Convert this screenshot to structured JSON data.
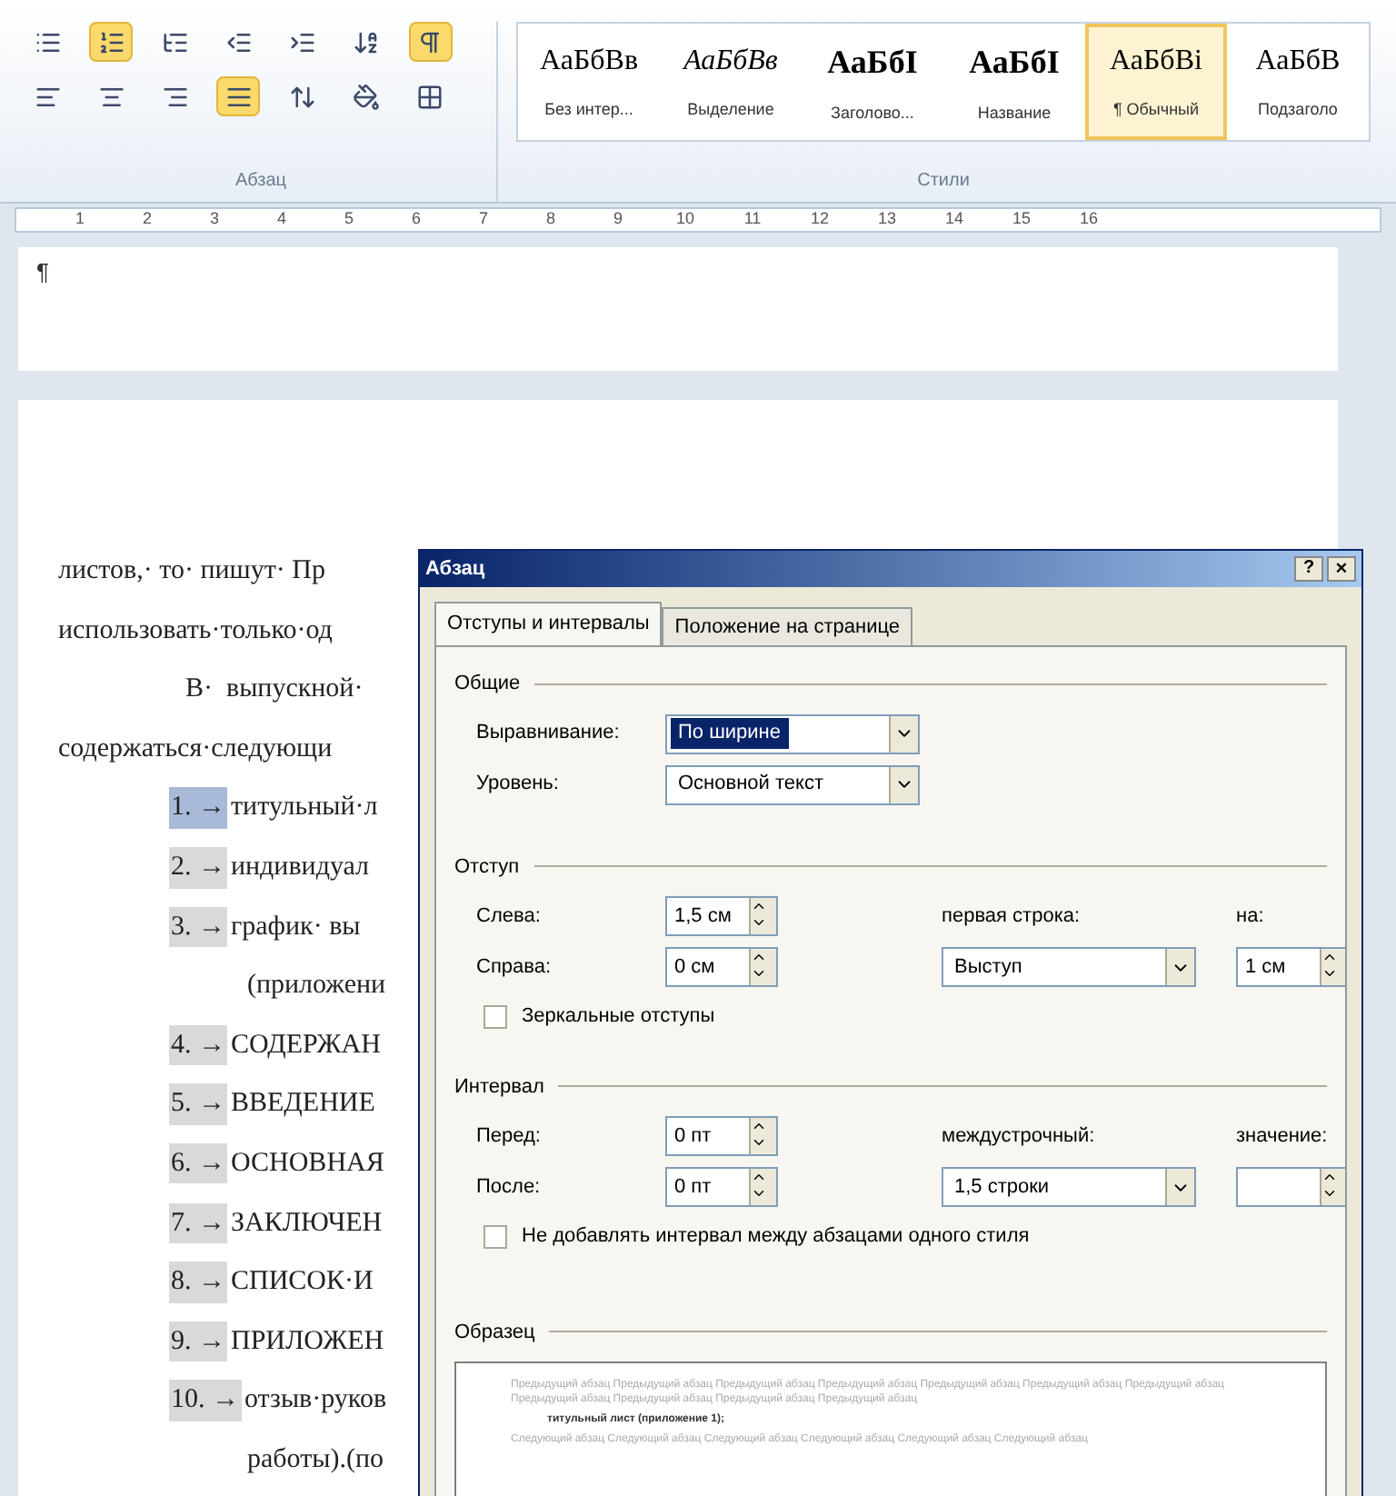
{
  "ribbon": {
    "paragraph_group": {
      "label": "Абзац",
      "tools": [
        {
          "kind": "bullets",
          "on": false
        },
        {
          "kind": "numbering",
          "on": true
        },
        {
          "kind": "multilevel",
          "on": false
        },
        {
          "kind": "outdent",
          "on": false
        },
        {
          "kind": "indent",
          "on": false
        },
        {
          "kind": "sort",
          "on": false
        },
        {
          "kind": "pilcrow",
          "on": true
        },
        {
          "kind": "align-left",
          "on": false
        },
        {
          "kind": "align-center",
          "on": false
        },
        {
          "kind": "align-right",
          "on": false
        },
        {
          "kind": "justify",
          "on": true
        },
        {
          "kind": "line-spacing",
          "on": false
        },
        {
          "kind": "shading",
          "on": false
        },
        {
          "kind": "borders",
          "on": false
        }
      ]
    },
    "styles_group": {
      "label": "Стили",
      "styles": [
        {
          "sample": "АаБбВв",
          "name": "Без интер...",
          "kind": "plain",
          "selected": false
        },
        {
          "sample": "АаБбВв",
          "name": "Выделение",
          "kind": "italic",
          "selected": false
        },
        {
          "sample": "АаБбI",
          "name": "Заголово...",
          "kind": "bold",
          "selected": false
        },
        {
          "sample": "АаБбI",
          "name": "Название",
          "kind": "bold",
          "selected": false
        },
        {
          "sample": "АаБбВі",
          "name": "¶ Обычный",
          "kind": "plain",
          "selected": true
        },
        {
          "sample": "АаБбВ",
          "name": "Подзаголо",
          "kind": "plain",
          "selected": false
        }
      ]
    }
  },
  "ruler": {
    "numbers": [
      "1",
      "2",
      "3",
      "4",
      "5",
      "6",
      "7",
      "8",
      "9",
      "10",
      "11",
      "12",
      "13",
      "14",
      "15",
      "16"
    ]
  },
  "document": {
    "page_mark": "¶",
    "lines": [
      {
        "kind": "text",
        "text": "листов,· то· пишут· Пр"
      },
      {
        "kind": "text",
        "text": "использовать·только·од"
      },
      {
        "kind": "indent",
        "text": "В·  выпускной·"
      },
      {
        "kind": "text",
        "text": "содержаться·следующи"
      },
      {
        "kind": "item",
        "number": "1.",
        "text": "титульный·л",
        "selected": true
      },
      {
        "kind": "item",
        "number": "2.",
        "text": "индивидуал",
        "selected": false
      },
      {
        "kind": "item",
        "number": "3.",
        "text": "график·  вы",
        "selected": false
      },
      {
        "kind": "cont",
        "text": "(приложени"
      },
      {
        "kind": "item",
        "number": "4.",
        "text": "СОДЕРЖАН",
        "selected": false
      },
      {
        "kind": "item",
        "number": "5.",
        "text": "ВВЕДЕНИЕ",
        "selected": false
      },
      {
        "kind": "item",
        "number": "6.",
        "text": "ОСНОВНАЯ",
        "selected": false
      },
      {
        "kind": "item",
        "number": "7.",
        "text": "ЗАКЛЮЧЕН",
        "selected": false
      },
      {
        "kind": "item",
        "number": "8.",
        "text": "СПИСОК·И",
        "selected": false
      },
      {
        "kind": "item",
        "number": "9.",
        "text": "ПРИЛОЖЕН",
        "selected": false
      },
      {
        "kind": "item",
        "number": "10.",
        "text": "отзыв·руков",
        "selected": false
      },
      {
        "kind": "cont",
        "text": "работы).(по"
      }
    ],
    "tab_arrow": "→"
  },
  "dialog": {
    "title": "Абзац",
    "help": "?",
    "close": "×",
    "tabs": [
      {
        "label": "Отступы и интервалы",
        "selected": true
      },
      {
        "label": "Положение на странице",
        "selected": false
      }
    ],
    "general": {
      "title": "Общие",
      "alignment": {
        "label": "Выравнивание:",
        "value": "По ширине"
      },
      "level": {
        "label": "Уровень:",
        "value": "Основной текст"
      }
    },
    "indent": {
      "title": "Отступ",
      "left": {
        "label": "Слева:",
        "value": "1,5 см"
      },
      "right": {
        "label": "Справа:",
        "value": "0 см"
      },
      "first_line": {
        "label": "первая строка:",
        "value": "Выступ"
      },
      "by": {
        "label": "на:",
        "value": "1 см"
      },
      "mirror": {
        "label": "Зеркальные отступы",
        "checked": false
      }
    },
    "spacing": {
      "title": "Интервал",
      "before": {
        "label": "Перед:",
        "value": "0 пт"
      },
      "after": {
        "label": "После:",
        "value": "0 пт"
      },
      "line": {
        "label": "междустрочный:",
        "value": "1,5 строки"
      },
      "at": {
        "label": "значение:"
      },
      "no_space": {
        "label": "Не добавлять интервал между абзацами одного стиля",
        "checked": false
      }
    },
    "preview": {
      "title": "Образец",
      "before": "Предыдущий абзац Предыдущий абзац Предыдущий абзац Предыдущий абзац Предыдущий абзац Предыдущий абзац Предыдущий абзац Предыдущий абзац Предыдущий абзац Предыдущий абзац Предыдущий абзац",
      "current": "титульный лист (приложение 1);",
      "after": "Следующий абзац Следующий абзац Следующий абзац Следующий абзац Следующий абзац Следующий абзац"
    }
  }
}
